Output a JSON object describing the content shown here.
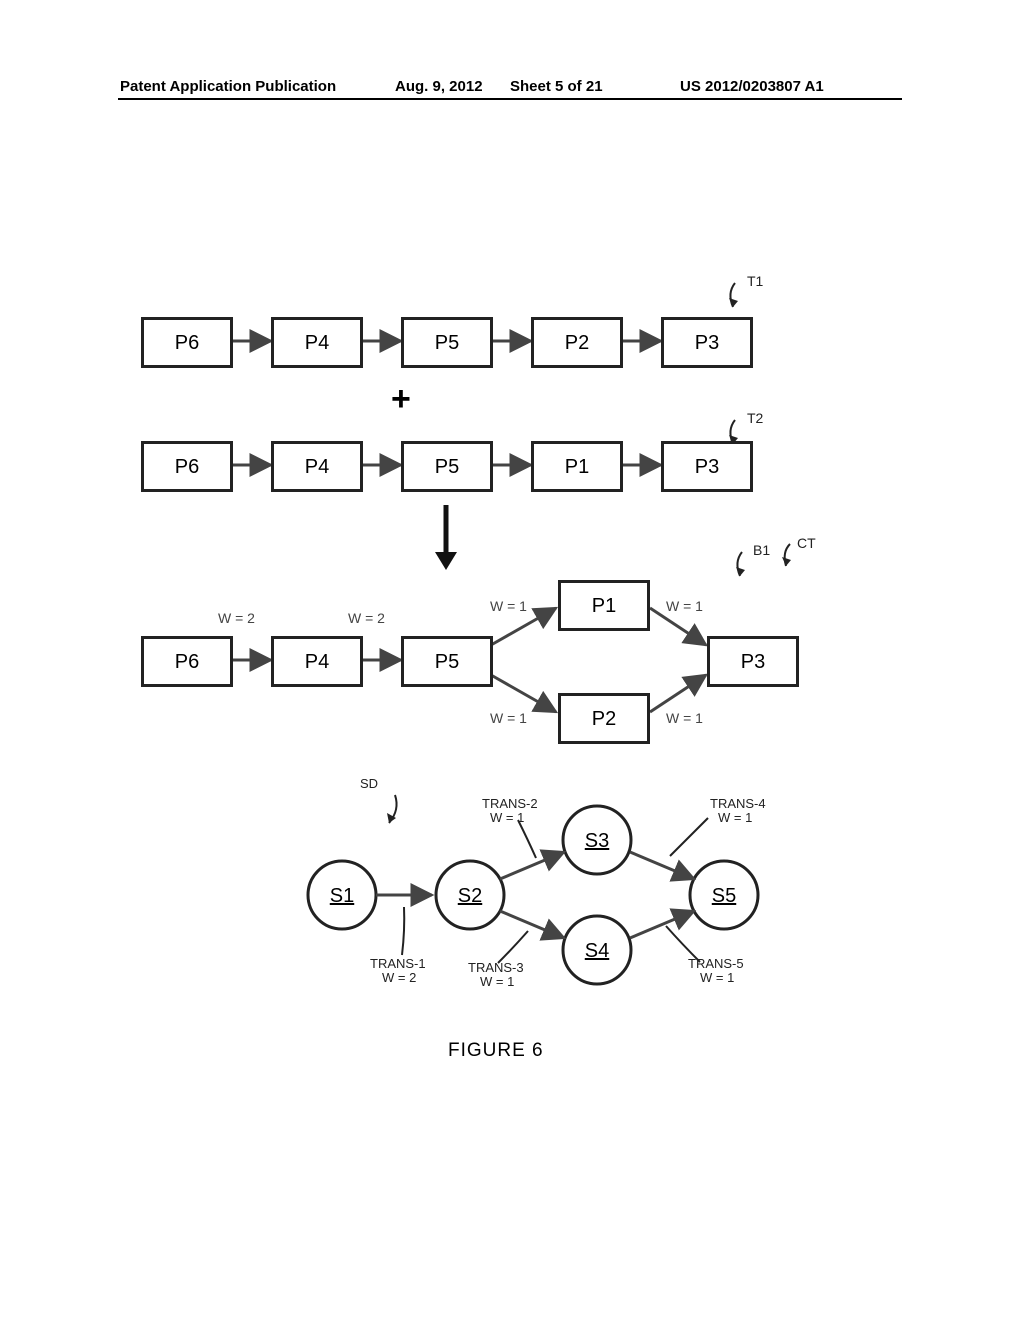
{
  "header": {
    "left": "Patent Application Publication",
    "date": "Aug. 9, 2012",
    "sheet": "Sheet 5 of 21",
    "pubno": "US 2012/0203807 A1"
  },
  "row1": {
    "b1": "P6",
    "b2": "P4",
    "b3": "P5",
    "b4": "P2",
    "b5": "P3",
    "tag": "T1"
  },
  "plus": "+",
  "row2": {
    "b1": "P6",
    "b2": "P4",
    "b3": "P5",
    "b4": "P1",
    "b5": "P3",
    "tag": "T2"
  },
  "row3": {
    "b1": "P6",
    "b2": "P4",
    "b3": "P5",
    "btop": "P1",
    "bbot": "P2",
    "bend": "P3",
    "w12": "W = 2",
    "w23": "W = 2",
    "w3top": "W = 1",
    "wtope": "W = 1",
    "w3bot": "W = 1",
    "wbote": "W = 1",
    "tagB1": "B1",
    "tagCT": "CT"
  },
  "sd": {
    "label_sd": "SD",
    "s1": "S1",
    "s2": "S2",
    "s3": "S3",
    "s4": "S4",
    "s5": "S5",
    "t1": "TRANS-1",
    "t1w": "W = 2",
    "t2": "TRANS-2",
    "t2w": "W = 1",
    "t3": "TRANS-3",
    "t3w": "W = 1",
    "t4": "TRANS-4",
    "t4w": "W = 1",
    "t5": "TRANS-5",
    "t5w": "W = 1"
  },
  "caption": "FIGURE 6"
}
